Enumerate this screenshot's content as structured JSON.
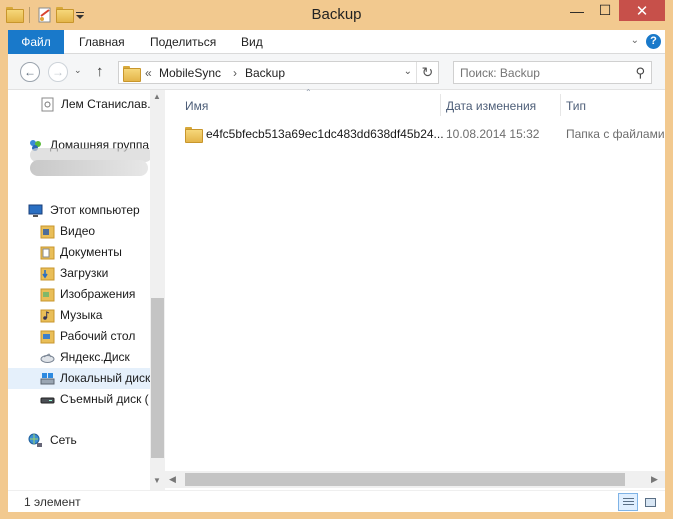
{
  "window": {
    "title": "Backup",
    "controls": {
      "minimize": "—",
      "maximize": "☐",
      "close": "✕"
    }
  },
  "ribbon": {
    "tabs": [
      "Файл",
      "Главная",
      "Поделиться",
      "Вид"
    ],
    "help": "?"
  },
  "navigation": {
    "back": "←",
    "forward": "→",
    "up": "↑",
    "recent": "⌄",
    "breadcrumb": {
      "overflow": "«",
      "items": [
        "MobileSync",
        "Backup"
      ],
      "separator": "›"
    },
    "refresh": "↻",
    "search_placeholder": "Поиск: Backup"
  },
  "sidebar": {
    "items": [
      {
        "label": "Лем Станислав.",
        "icon": "document-icon"
      },
      {
        "label": "Домашняя группа",
        "icon": "homegroup-icon"
      },
      {
        "label": "Этот компьютер",
        "icon": "computer-icon"
      },
      {
        "label": "Видео",
        "icon": "video-folder-icon"
      },
      {
        "label": "Документы",
        "icon": "documents-folder-icon"
      },
      {
        "label": "Загрузки",
        "icon": "downloads-folder-icon"
      },
      {
        "label": "Изображения",
        "icon": "pictures-folder-icon"
      },
      {
        "label": "Музыка",
        "icon": "music-folder-icon"
      },
      {
        "label": "Рабочий стол",
        "icon": "desktop-folder-icon"
      },
      {
        "label": "Яндекс.Диск",
        "icon": "yandex-disk-icon"
      },
      {
        "label": "Локальный диск",
        "icon": "local-disk-icon"
      },
      {
        "label": "Съемный диск (",
        "icon": "removable-disk-icon"
      },
      {
        "label": "Сеть",
        "icon": "network-icon"
      }
    ]
  },
  "content": {
    "columns": {
      "name": "Имя",
      "date": "Дата изменения",
      "type": "Тип"
    },
    "rows": [
      {
        "name": "e4fc5bfecb513a69ec1dc483dd638df45b24...",
        "date": "10.08.2014 15:32",
        "type": "Папка с файлами"
      }
    ]
  },
  "status": {
    "count": "1 элемент"
  },
  "colors": {
    "frame": "#f2c98f",
    "file_tab": "#1979ca",
    "close_button": "#c7504a",
    "selection": "#e5f0fb"
  }
}
